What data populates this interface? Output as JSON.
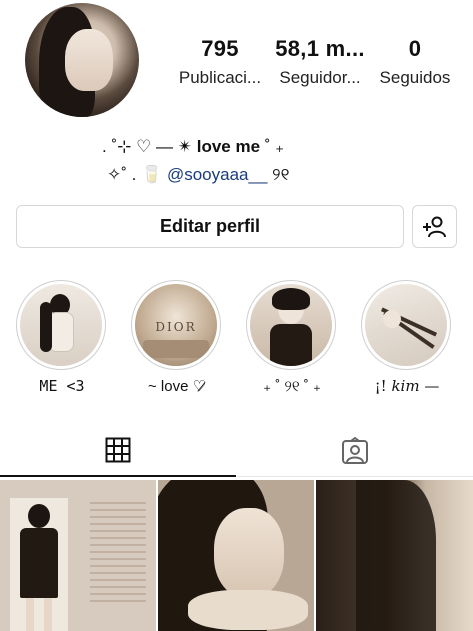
{
  "profile": {
    "stats": [
      {
        "value": "795",
        "label": "Publicaci..."
      },
      {
        "value": "58,1 m...",
        "label": "Seguidor..."
      },
      {
        "value": "0",
        "label": "Seguidos"
      }
    ],
    "bio": {
      "line1_prefix": ". ˚⊹ ♡ — ✴ ",
      "line1_bold": "love me",
      "line1_suffix": " ˚ ₊",
      "line2_prefix": "✧˚ . 🥛 ",
      "line2_handle": "@sooyaaa__",
      "line2_suffix": " ୨୧"
    }
  },
  "actions": {
    "edit_label": "Editar perfil",
    "add_icon": "add-person-icon"
  },
  "highlights": [
    {
      "label": "ME <3"
    },
    {
      "label": "~ love ♡̷"
    },
    {
      "label": "₊ ˚ ୨୧ ˚ ₊"
    },
    {
      "label_prefix": "¡! ",
      "label_italic": "kim",
      "label_suffix": " —"
    }
  ],
  "tabs": {
    "grid_icon": "grid-icon",
    "tagged_icon": "tagged-user-icon"
  },
  "colors": {
    "handle": "#1a3d7a",
    "border": "#d8d8d8"
  }
}
